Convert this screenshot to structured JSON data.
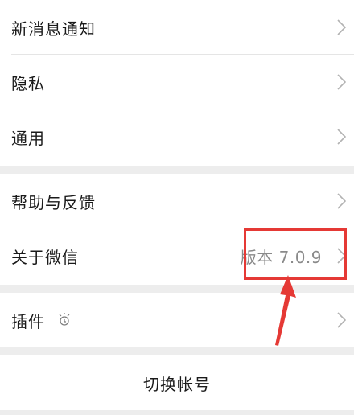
{
  "settings": {
    "group1": [
      {
        "label": "新消息通知",
        "icon": "chevron-right-icon"
      },
      {
        "label": "隐私",
        "icon": "chevron-right-icon"
      },
      {
        "label": "通用",
        "icon": "chevron-right-icon"
      }
    ],
    "group2": [
      {
        "label": "帮助与反馈",
        "icon": "chevron-right-icon"
      },
      {
        "label": "关于微信",
        "value": "版本 7.0.9",
        "icon": "chevron-right-icon"
      }
    ],
    "group3": [
      {
        "label": "插件",
        "badge_icon": "plugin-bulb-icon",
        "icon": "chevron-right-icon"
      }
    ],
    "switch_account": "切换帐号"
  },
  "annotation": {
    "highlight_color": "#e53935",
    "target": "版本 7.0.9"
  },
  "colors": {
    "background": "#ededed",
    "card": "#ffffff",
    "divider": "#e5e5e5",
    "secondary_text": "#8a8a8a",
    "annotation_red": "#e53935"
  }
}
